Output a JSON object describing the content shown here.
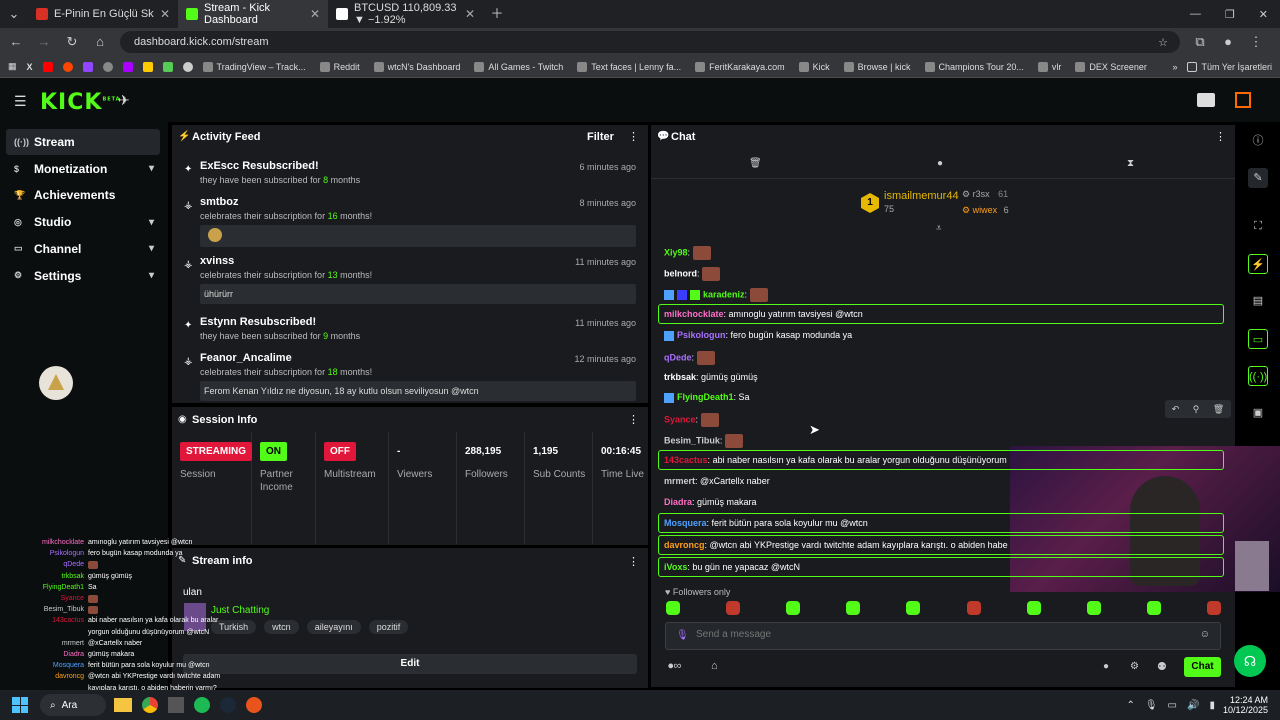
{
  "tabs": [
    {
      "label": "E-Pinin En Güçlü Skilli - Pindin...",
      "color": "#d93025"
    },
    {
      "label": "Stream - Kick Dashboard",
      "color": "#53fc18"
    },
    {
      "label": "BTCUSD 110,809.33 ▼ −1.92%",
      "color": "#ffffff"
    }
  ],
  "url": "dashboard.kick.com/stream",
  "bookmarks": [
    "TradingView – Track...",
    "Reddit",
    "wtcN's Dashboard",
    "All Games - Twitch",
    "Text faces | Lenny fa...",
    "FeritKarakaya.com",
    "Kick",
    "Browse | kick",
    "Champions Tour 20...",
    "vlr",
    "DEX Screener"
  ],
  "bookmarks_folder": "Tüm Yer İşaretleri",
  "logo": "KICK",
  "logo_beta": "BETA",
  "sidebar": [
    {
      "label": "Stream",
      "icon": "stream-icon",
      "chevron": false
    },
    {
      "label": "Monetization",
      "icon": "money-icon",
      "chevron": true
    },
    {
      "label": "Achievements",
      "icon": "trophy-icon",
      "chevron": false
    },
    {
      "label": "Studio",
      "icon": "studio-icon",
      "chevron": true
    },
    {
      "label": "Channel",
      "icon": "channel-icon",
      "chevron": true
    },
    {
      "label": "Settings",
      "icon": "gear-icon",
      "chevron": true
    }
  ],
  "activity": {
    "title": "Activity Feed",
    "filter": "Filter",
    "items": [
      {
        "name": "ExEscc Resubscribed!",
        "pre": "they have been subscribed for ",
        "num": "8",
        "post": " months",
        "time": "6 minutes ago",
        "msg": ""
      },
      {
        "name": "smtboz",
        "pre": "celebrates their subscription for ",
        "num": "16",
        "post": " months!",
        "time": "8 minutes ago",
        "msg": ""
      },
      {
        "name": "xvinss",
        "pre": "celebrates their subscription for ",
        "num": "13",
        "post": " months!",
        "time": "11 minutes ago",
        "msg": "ühürürr"
      },
      {
        "name": "Estynn Resubscribed!",
        "pre": "they have been subscribed for ",
        "num": "9",
        "post": " months",
        "time": "11 minutes ago",
        "msg": ""
      },
      {
        "name": "Feanor_Ancalime",
        "pre": "celebrates their subscription for ",
        "num": "18",
        "post": " months!",
        "time": "12 minutes ago",
        "msg": "Ferom Kenan Yıldız ne diyosun, 18 ay kutlu olsun seviliyosun @wtcn"
      }
    ]
  },
  "session": {
    "title": "Session Info",
    "cells": [
      {
        "value": "STREAMING",
        "label": "Session",
        "badge": "#e0163a"
      },
      {
        "value": "ON",
        "label": "Partner Income",
        "badge": "#53fc18"
      },
      {
        "value": "OFF",
        "label": "Multistream",
        "badge": "#e0163a"
      },
      {
        "value": "-",
        "label": "Viewers",
        "badge": ""
      },
      {
        "value": "288,195",
        "label": "Followers",
        "badge": ""
      },
      {
        "value": "1,195",
        "label": "Sub Counts",
        "badge": ""
      },
      {
        "value": "00:16:45",
        "label": "Time Live",
        "badge": ""
      }
    ]
  },
  "streaminfo": {
    "title": "Stream info",
    "name": "ulan",
    "category": "Just Chatting",
    "tags": [
      "Turkish",
      "wtcn",
      "aileyayını",
      "pozitif"
    ],
    "edit": "Edit"
  },
  "chat": {
    "title": "Chat",
    "top": {
      "user": "ismailmemur44",
      "count": "75",
      "r2": "r3sx",
      "r2n": "61",
      "r3": "wiwex",
      "r3n": "6",
      "rank": "1"
    },
    "messages": [
      {
        "user": "Xiy98",
        "color": "#53fc18",
        "text": "",
        "emote": true,
        "hl": false
      },
      {
        "user": "belnord",
        "color": "#ffffff",
        "text": "",
        "emote": true,
        "hl": false
      },
      {
        "user": "karadeniz",
        "color": "#53fc18",
        "text": "",
        "emote": true,
        "hl": false
      },
      {
        "user": "milkchocklate",
        "color": "#ff6ec7",
        "text": "amınoglu yatırım tavsiyesi @wtcn",
        "emote": false,
        "hl": true
      },
      {
        "user": "Psikologun",
        "color": "#a970ff",
        "text": "fero bugün kasap modunda ya",
        "emote": false,
        "hl": false
      },
      {
        "user": "qDede",
        "color": "#a970ff",
        "text": "",
        "emote": true,
        "hl": false
      },
      {
        "user": "trkbsak",
        "color": "#ffffff",
        "text": "gümüş gümüş",
        "emote": false,
        "hl": false
      },
      {
        "user": "FlyingDeath1",
        "color": "#53fc18",
        "text": "Sa",
        "emote": false,
        "hl": false
      },
      {
        "user": "Syance",
        "color": "#e0163a",
        "text": "",
        "emote": true,
        "hl": false
      },
      {
        "user": "Besim_Tibuk",
        "color": "#cccccc",
        "text": "",
        "emote": true,
        "hl": false
      },
      {
        "user": "143cactus",
        "color": "#e0163a",
        "text": "abi naber nasılsın ya kafa olarak bu aralar yorgun olduğunu düşünüyorum",
        "emote": false,
        "hl": true
      },
      {
        "user": "mrmert",
        "color": "#cccccc",
        "text": "@xCartellx naber",
        "emote": false,
        "hl": false
      },
      {
        "user": "Diadra",
        "color": "#ff6ec7",
        "text": "gümüş makara",
        "emote": false,
        "hl": false
      },
      {
        "user": "Mosquera",
        "color": "#4ea1ff",
        "text": "ferit bütün para sola koyulur mu @wtcn",
        "emote": false,
        "hl": true
      },
      {
        "user": "davroncg",
        "color": "#ff9f1a",
        "text": "@wtcn abi YKPrestige vardı twitchte adam kayıplara karıştı. o abiden haberin varmı?",
        "emote": false,
        "hl": true
      },
      {
        "user": "iVoxs",
        "color": "#53fc18",
        "text": "bu gün ne yapacaz @wtcN",
        "emote": false,
        "hl": true
      }
    ],
    "followers_only": "Followers only",
    "placeholder": "Send a message",
    "send": "Chat"
  },
  "overlay": [
    {
      "user": "milkchocklate",
      "text": "amınoglu yatırım tavsiyesi @wtcn",
      "color": "#ff6ec7"
    },
    {
      "user": "Psikologun",
      "text": "fero bugün kasap modunda ya",
      "color": "#a970ff"
    },
    {
      "user": "qDede",
      "text": "",
      "color": "#a970ff"
    },
    {
      "user": "trkbsak",
      "text": "gümüş gümüş",
      "color": "#53fc18"
    },
    {
      "user": "FlyingDeath1",
      "text": "Sa",
      "color": "#53fc18"
    },
    {
      "user": "Syance",
      "text": "",
      "color": "#e0163a"
    },
    {
      "user": "Besim_Tibuk",
      "text": "",
      "color": "#cccccc"
    },
    {
      "user": "143cactus",
      "text": "abi naber nasılsın ya kafa olarak bu aralar",
      "color": "#e0163a"
    },
    {
      "user": "",
      "text": "yorgun olduğunu düşünüyorum @wtcN",
      "color": "#ffffff"
    },
    {
      "user": "mrmert",
      "text": "@xCartellx naber",
      "color": "#cccccc"
    },
    {
      "user": "Diadra",
      "text": "gümüş makara",
      "color": "#ff6ec7"
    },
    {
      "user": "Mosquera",
      "text": "ferit bütün para sola koyulur mu @wtcn",
      "color": "#4ea1ff"
    },
    {
      "user": "davroncg",
      "text": "@wtcn abi YKPrestige vardı twitchte adam",
      "color": "#ff9f1a"
    },
    {
      "user": "",
      "text": "kayıplara karıştı. o abiden haberin varmı?",
      "color": "#ffffff"
    },
    {
      "user": "iVoxs",
      "text": "bu gün ne yapacaz @wtcN",
      "color": "#53fc18"
    }
  ],
  "taskbar": {
    "search": "Ara",
    "time": "12:24 AM",
    "date": "10/12/2025"
  }
}
